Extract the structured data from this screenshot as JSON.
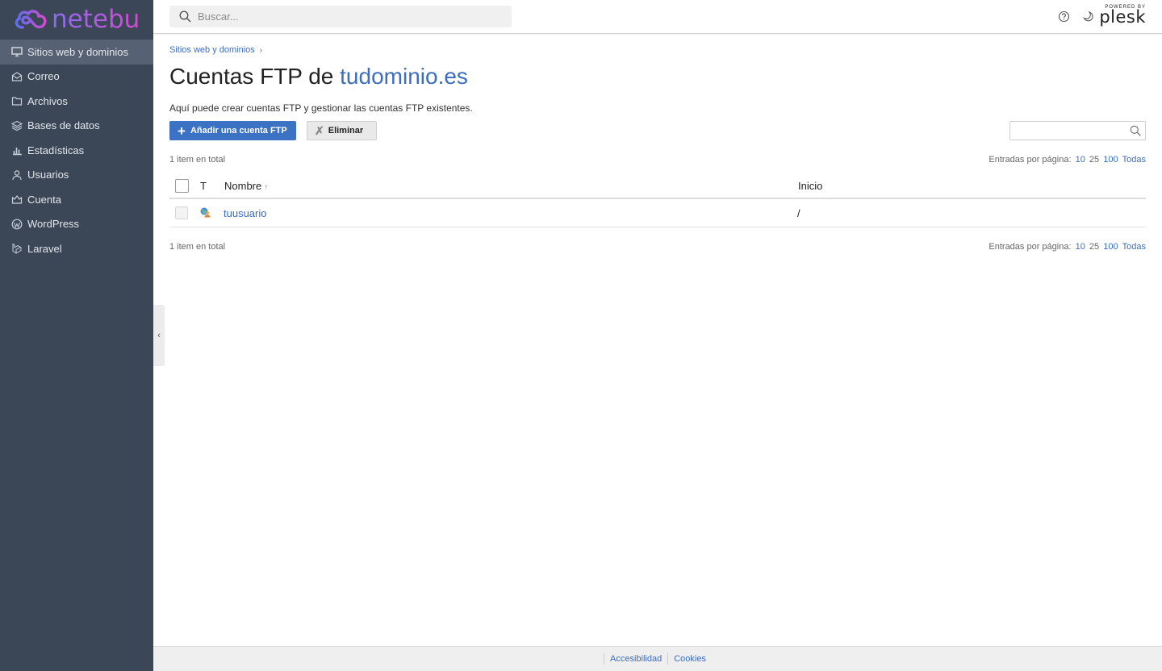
{
  "brand": {
    "name": "netebu"
  },
  "header": {
    "search_placeholder": "Buscar...",
    "powered_by": "POWERED BY",
    "plesk": "plesk"
  },
  "sidebar": {
    "items": [
      {
        "label": "Sitios web y dominios",
        "icon": "monitor-icon",
        "active": true
      },
      {
        "label": "Correo",
        "icon": "mail-icon"
      },
      {
        "label": "Archivos",
        "icon": "folder-icon"
      },
      {
        "label": "Bases de datos",
        "icon": "database-icon"
      },
      {
        "label": "Estadísticas",
        "icon": "stats-icon"
      },
      {
        "label": "Usuarios",
        "icon": "user-icon"
      },
      {
        "label": "Cuenta",
        "icon": "account-icon"
      },
      {
        "label": "WordPress",
        "icon": "wordpress-icon"
      },
      {
        "label": "Laravel",
        "icon": "laravel-icon"
      }
    ]
  },
  "main": {
    "breadcrumb": "Sitios web y dominios",
    "title_prefix": "Cuentas FTP de",
    "title_domain": "tudominio.es",
    "hint": "Aquí puede crear cuentas FTP y gestionar las cuentas FTP existentes.",
    "add_button": "Añadir una cuenta FTP",
    "delete_button": "Eliminar",
    "total_items": "1 item en total",
    "per_page_label": "Entradas por página:",
    "per_page_options": [
      "10",
      "25",
      "100",
      "Todas"
    ],
    "table": {
      "columns": {
        "type": "T",
        "name": "Nombre",
        "home": "Inicio"
      },
      "rows": [
        {
          "name": "tuusuario",
          "home": "/"
        }
      ]
    }
  },
  "footer": {
    "accessibility": "Accesibilidad",
    "cookies": "Cookies"
  },
  "colors": {
    "sidebar_bg": "#3b4656",
    "sidebar_active": "#566273",
    "link": "#3c6dbf",
    "primary_button": "#3c72c4",
    "brand_gradient_start": "#8b6cf0",
    "brand_gradient_end": "#d24bd0"
  }
}
